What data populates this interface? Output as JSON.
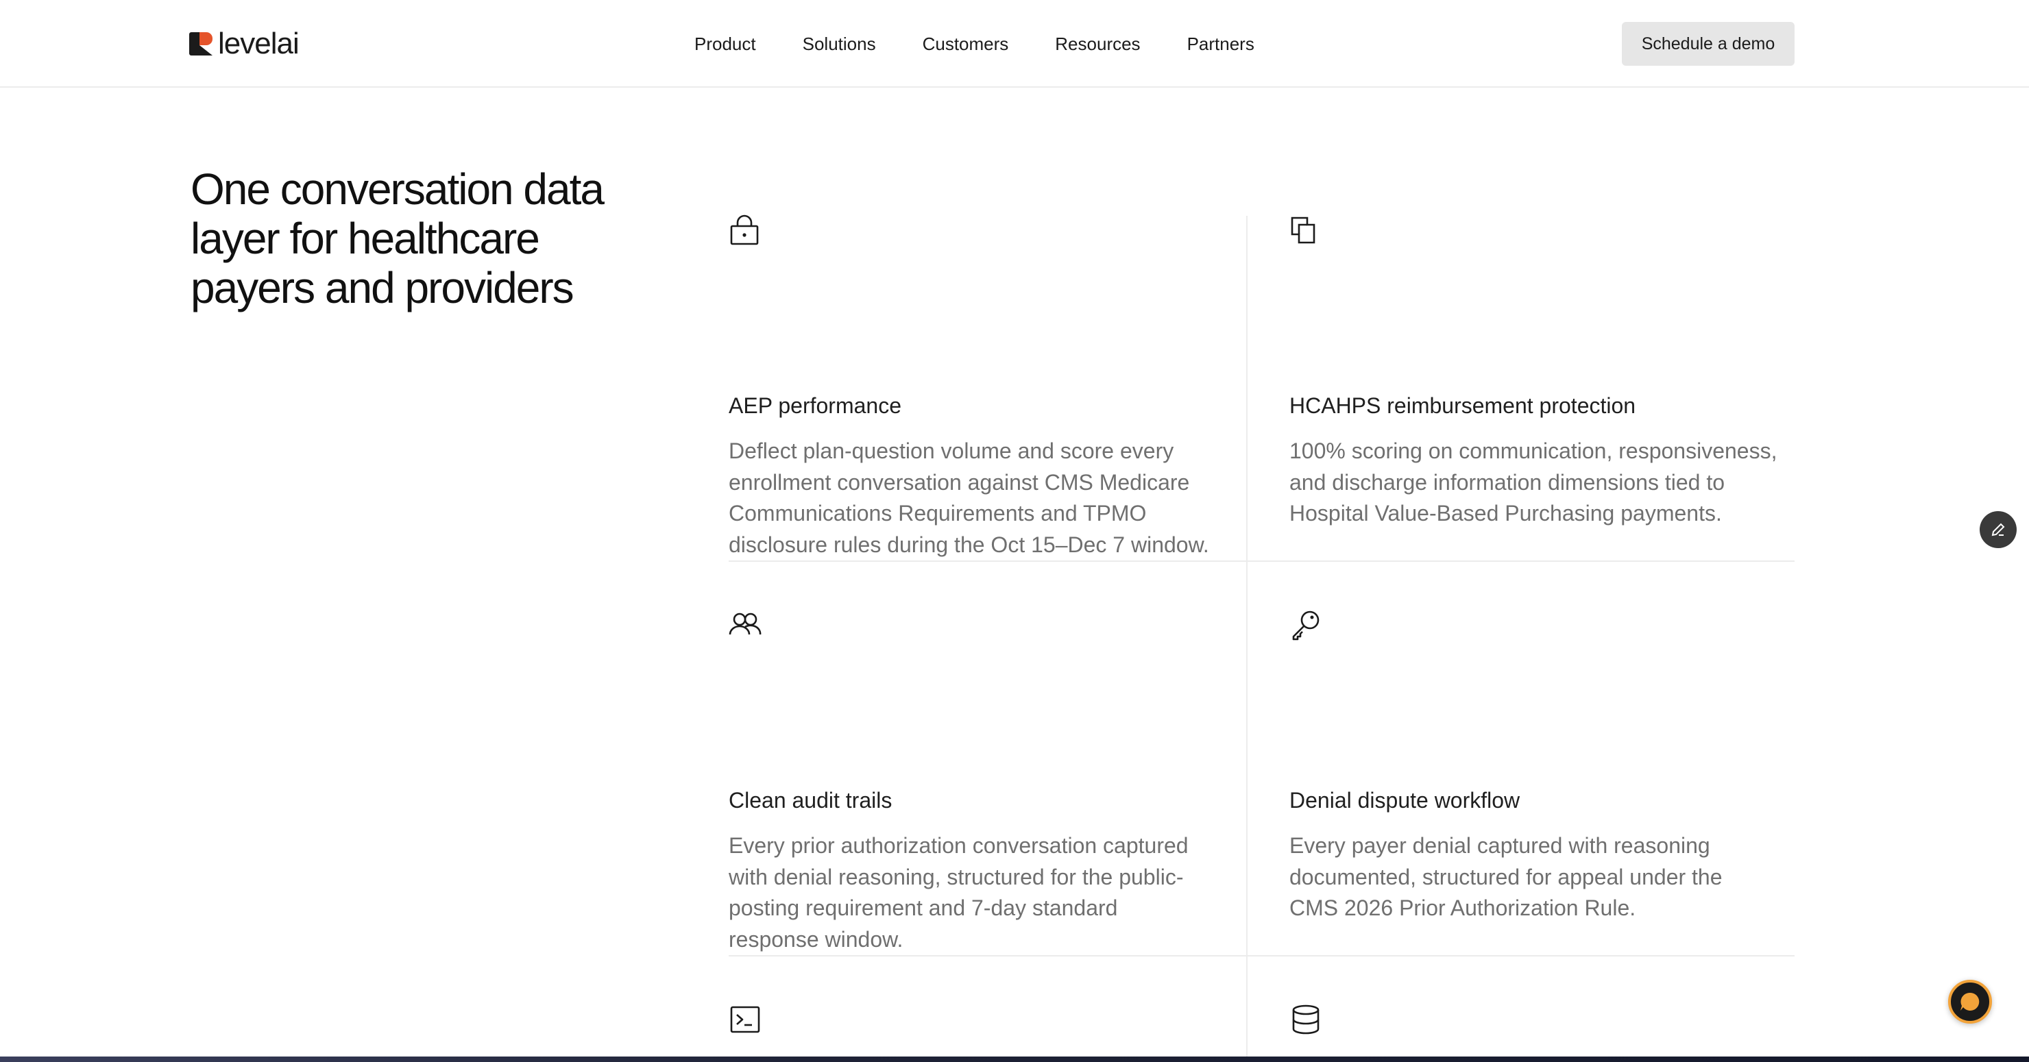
{
  "header": {
    "logo_text": "levelai",
    "nav": [
      "Product",
      "Solutions",
      "Customers",
      "Resources",
      "Partners"
    ],
    "cta_label": "Schedule a demo"
  },
  "hero": {
    "heading": "One conversation data layer for healthcare payers and providers"
  },
  "cards": [
    {
      "icon": "lock-icon",
      "title": "AEP performance",
      "desc": "Deflect plan-question volume and score every enrollment conversation against CMS Medicare Communications Requirements and TPMO disclosure rules during the Oct 15–Dec 7 window."
    },
    {
      "icon": "copy-squares-icon",
      "title": "HCAHPS reimbursement protection",
      "desc": "100% scoring on communication, responsiveness, and discharge information dimensions tied to Hospital Value-Based Purchasing payments."
    },
    {
      "icon": "users-icon",
      "title": "Clean audit trails",
      "desc": "Every prior authorization conversation captured with denial reasoning, structured for the public-posting requirement and 7-day standard response window."
    },
    {
      "icon": "key-icon",
      "title": "Denial dispute workflow",
      "desc": "Every payer denial captured with reasoning documented, structured for appeal under the CMS 2026 Prior Authorization Rule."
    },
    {
      "icon": "terminal-icon"
    },
    {
      "icon": "database-icon"
    }
  ],
  "colors": {
    "brand_orange": "#e5542b",
    "text_dark": "#1a1a1a",
    "text_muted": "#6f6f6f",
    "divider": "#ececec",
    "cta_bg": "#e6e6e6",
    "chat_ring": "#f2a33a"
  }
}
